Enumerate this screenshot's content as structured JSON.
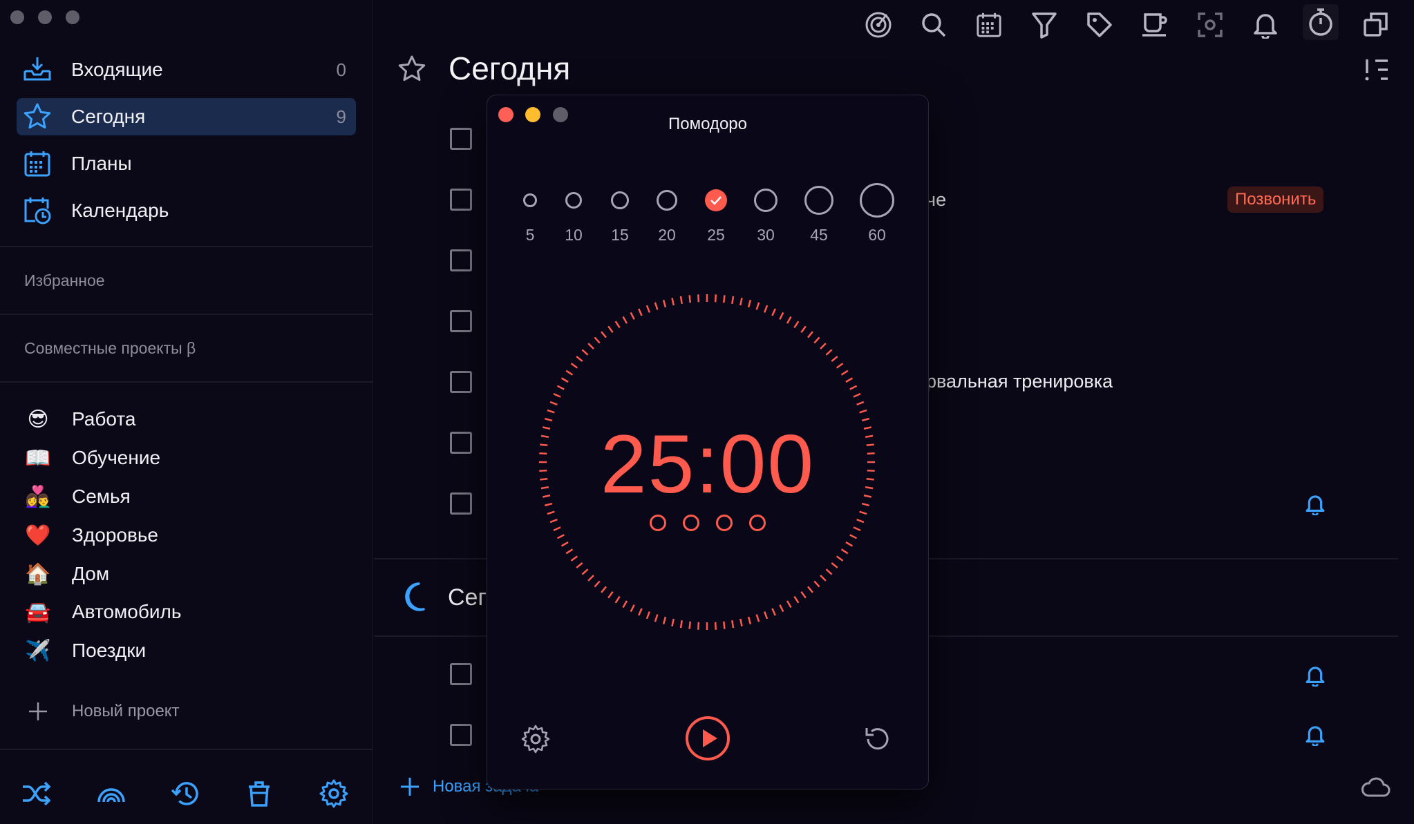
{
  "sidebar": {
    "nav": [
      {
        "label": "Входящие",
        "count": "0",
        "icon": "inbox-icon"
      },
      {
        "label": "Сегодня",
        "count": "9",
        "icon": "star-icon"
      },
      {
        "label": "Планы",
        "count": "",
        "icon": "calendar-grid-icon"
      },
      {
        "label": "Календарь",
        "count": "",
        "icon": "calendar-clock-icon"
      }
    ],
    "favorites_label": "Избранное",
    "shared_label": "Совместные проекты β",
    "projects": [
      {
        "emoji": "😎",
        "label": "Работа"
      },
      {
        "emoji": "📖",
        "label": "Обучение"
      },
      {
        "emoji": "👩‍❤️‍👨",
        "label": "Семья"
      },
      {
        "emoji": "❤️",
        "label": "Здоровье"
      },
      {
        "emoji": "🏠",
        "label": "Дом"
      },
      {
        "emoji": "🚘",
        "label": "Автомобиль"
      },
      {
        "emoji": "✈️",
        "label": "Поездки"
      }
    ],
    "new_project": "Новый проект"
  },
  "main": {
    "title": "Сегодня",
    "section2_title": "Сег",
    "tasks_visible": [
      {
        "text": "че"
      },
      {
        "text": "рвальная тренировка"
      }
    ],
    "badge_call": "Позвонить",
    "new_task": "Новая задача"
  },
  "pomodoro": {
    "title": "Помодоро",
    "presets": [
      "5",
      "10",
      "15",
      "20",
      "25",
      "30",
      "45",
      "60"
    ],
    "selected_preset": "25",
    "timer": "25:00",
    "sessions": 4
  },
  "colors": {
    "accent_blue": "#3ba3ff",
    "timer_red": "#ff5a4e",
    "active_bg": "#1a2b4d"
  }
}
